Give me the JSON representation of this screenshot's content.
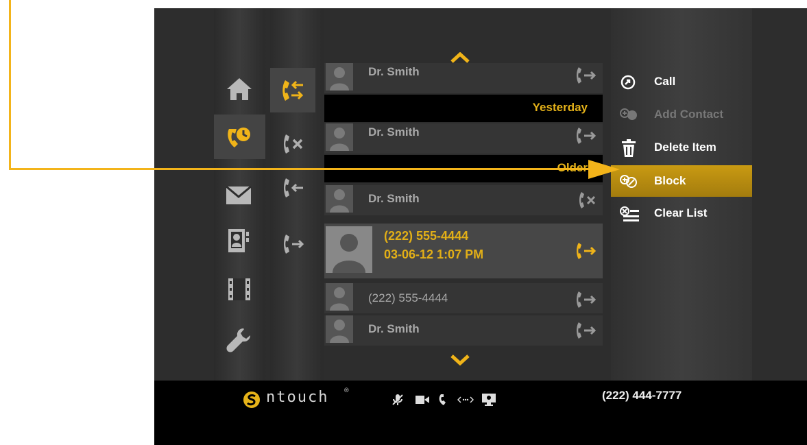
{
  "nav": {
    "items": [
      "home-icon",
      "recent-calls-icon",
      "messages-icon",
      "contacts-icon",
      "video-icon",
      "settings-icon"
    ],
    "selected": "recent-calls-icon"
  },
  "filters": {
    "items": [
      "all-calls-icon",
      "missed-calls-icon",
      "incoming-calls-icon",
      "outgoing-calls-icon"
    ],
    "selected": "all-calls-icon"
  },
  "call_list": {
    "rows": [
      {
        "name": "Dr. Smith",
        "direction": "outgoing"
      },
      {
        "name": "Dr. Smith",
        "direction": "outgoing"
      },
      {
        "name": "Dr. Smith",
        "direction": "missed"
      },
      {
        "name": "(222) 555-4444",
        "direction": "outgoing"
      },
      {
        "name": "Dr. Smith",
        "direction": "outgoing"
      }
    ],
    "dividers": [
      "Yesterday",
      "Older"
    ],
    "selected": {
      "number": "(222) 555-4444",
      "datetime": "03-06-12  1:07 PM",
      "direction": "outgoing"
    }
  },
  "menu": {
    "call": "Call",
    "add_contact": "Add Contact",
    "delete_item": "Delete Item",
    "block": "Block",
    "clear_list": "Clear List"
  },
  "footer": {
    "brand": "ntouch",
    "registered": "®",
    "status_icons": [
      "mic-muted-icon",
      "video-camera-icon",
      "phone-icon",
      "connection-icon",
      "screen-share-icon"
    ],
    "phone_number": "(222) 444-7777"
  },
  "colors": {
    "accent": "#e6b319",
    "pointer": "#f3b41a",
    "background": "#2d2d2d"
  }
}
